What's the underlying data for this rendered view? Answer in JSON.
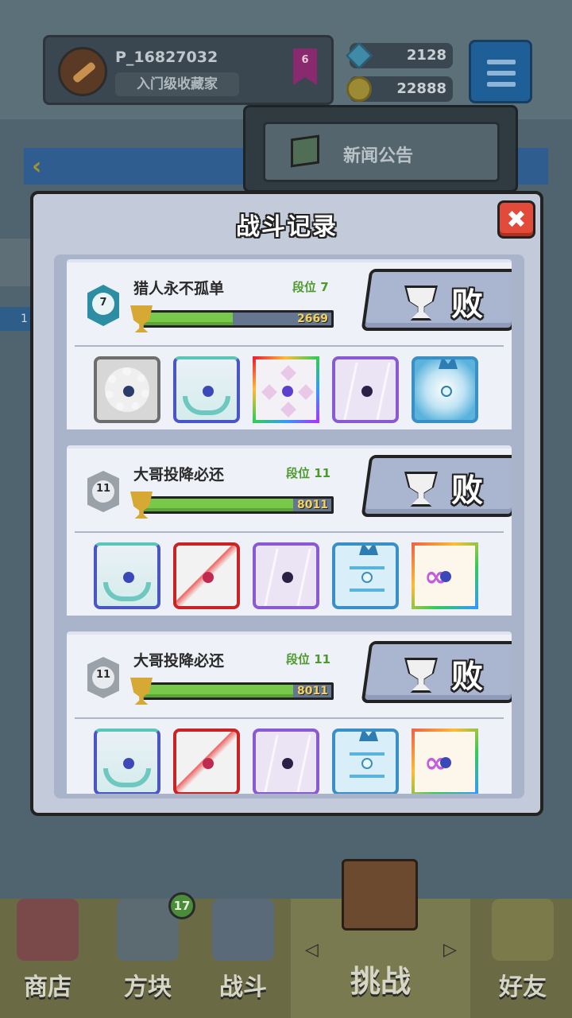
{
  "header": {
    "player_id": "P_16827032",
    "player_rank": "入门级收藏家",
    "level": "6",
    "gems": "2128",
    "coins": "22888"
  },
  "news_menu": {
    "label": "新闻公告"
  },
  "side_strip_label": "1",
  "modal": {
    "title": "战斗记录",
    "close_symbol": "✖"
  },
  "records": [
    {
      "rank_badge": "7",
      "player_name": "猎人永不孤单",
      "tier": "段位 7",
      "score": "2669",
      "score_fill": 0.48,
      "result": "败",
      "units": [
        "grey-cog",
        "healing-hands",
        "rainbow-diamond",
        "purple-crack",
        "ice-dragon-vortex"
      ]
    },
    {
      "rank_badge": "11",
      "player_name": "大哥投降必还",
      "tier": "段位 11",
      "score": "8011",
      "score_fill": 0.8,
      "result": "败",
      "units": [
        "healing-hands",
        "red-slash",
        "purple-crack",
        "ice-dragon-runes",
        "fire-dragon-infinity"
      ]
    },
    {
      "rank_badge": "11",
      "player_name": "大哥投降必还",
      "tier": "段位 11",
      "score": "8011",
      "score_fill": 0.8,
      "result": "败",
      "units": [
        "healing-hands",
        "red-slash",
        "purple-crack",
        "ice-dragon-runes",
        "fire-dragon-infinity"
      ]
    }
  ],
  "bottom_nav": {
    "shop": "商店",
    "blocks": "方块",
    "blocks_badge": "17",
    "battle": "战斗",
    "challenge": "挑战",
    "friends": "好友"
  },
  "colors": {
    "score_fill": "#78c84a",
    "tier_green": "#4d9a2c",
    "close_red": "#e24a3a",
    "modal_bg": "#c3cad9"
  }
}
